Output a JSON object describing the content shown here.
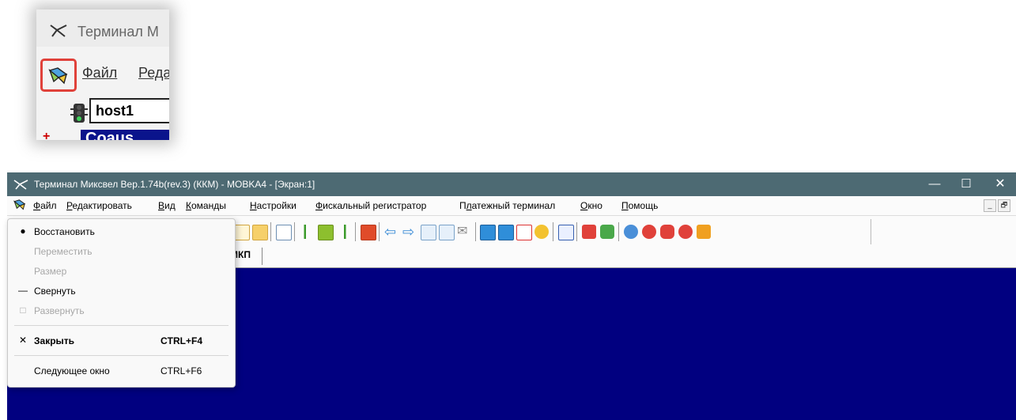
{
  "inset": {
    "title": "Терминал М",
    "menu_file": "Файл",
    "menu_edit": "Реда",
    "host_value": "host1",
    "bottom_text": "Coaus"
  },
  "window": {
    "title": "Терминал Миксвел Вер.1.74b(rev.3) (ККМ) - MOBKA4 - [Экран:1]",
    "controls": {
      "minimize": "—",
      "maximize": "☐",
      "close": "✕"
    }
  },
  "menubar": {
    "items": [
      {
        "key": "Ф",
        "rest": "айл"
      },
      {
        "key": "Р",
        "rest": "едактировать"
      },
      {
        "key": "В",
        "rest": "ид"
      },
      {
        "key": "К",
        "rest": "оманды"
      },
      {
        "key": "Н",
        "rest": "астройки"
      },
      {
        "key": "Ф",
        "rest": "искальный регистратор",
        "pre": ""
      },
      {
        "pre": "П",
        "key": "л",
        "rest": "атежный терминал"
      },
      {
        "key": "О",
        "rest": "кно"
      },
      {
        "key": "П",
        "rest": "омощь"
      }
    ],
    "mdi_buttons": [
      "_",
      "🗗"
    ]
  },
  "tabs": {
    "active": "МКП"
  },
  "sysmenu": {
    "items": [
      {
        "icon": "restore-icon",
        "glyph": "▫",
        "label": "Восстановить",
        "shortcut": "",
        "enabled": true,
        "bold": false
      },
      {
        "icon": "",
        "glyph": "",
        "label": "Переместить",
        "shortcut": "",
        "enabled": false,
        "bold": false
      },
      {
        "icon": "",
        "glyph": "",
        "label": "Размер",
        "shortcut": "",
        "enabled": false,
        "bold": false
      },
      {
        "icon": "minimize-icon",
        "glyph": "—",
        "label": "Свернуть",
        "shortcut": "",
        "enabled": true,
        "bold": false
      },
      {
        "icon": "maximize-icon",
        "glyph": "□",
        "label": "Развернуть",
        "shortcut": "",
        "enabled": false,
        "bold": false
      },
      {
        "icon": "close-icon",
        "glyph": "✕",
        "label": "Закрыть",
        "shortcut": "CTRL+F4",
        "enabled": true,
        "bold": true
      },
      {
        "icon": "",
        "glyph": "",
        "label": "Следующее окно",
        "shortcut": "CTRL+F6",
        "enabled": true,
        "bold": false
      }
    ]
  },
  "colors": {
    "titlebar": "#4d6a73",
    "workspace": "#010080",
    "highlight_box": "#e0413a"
  }
}
